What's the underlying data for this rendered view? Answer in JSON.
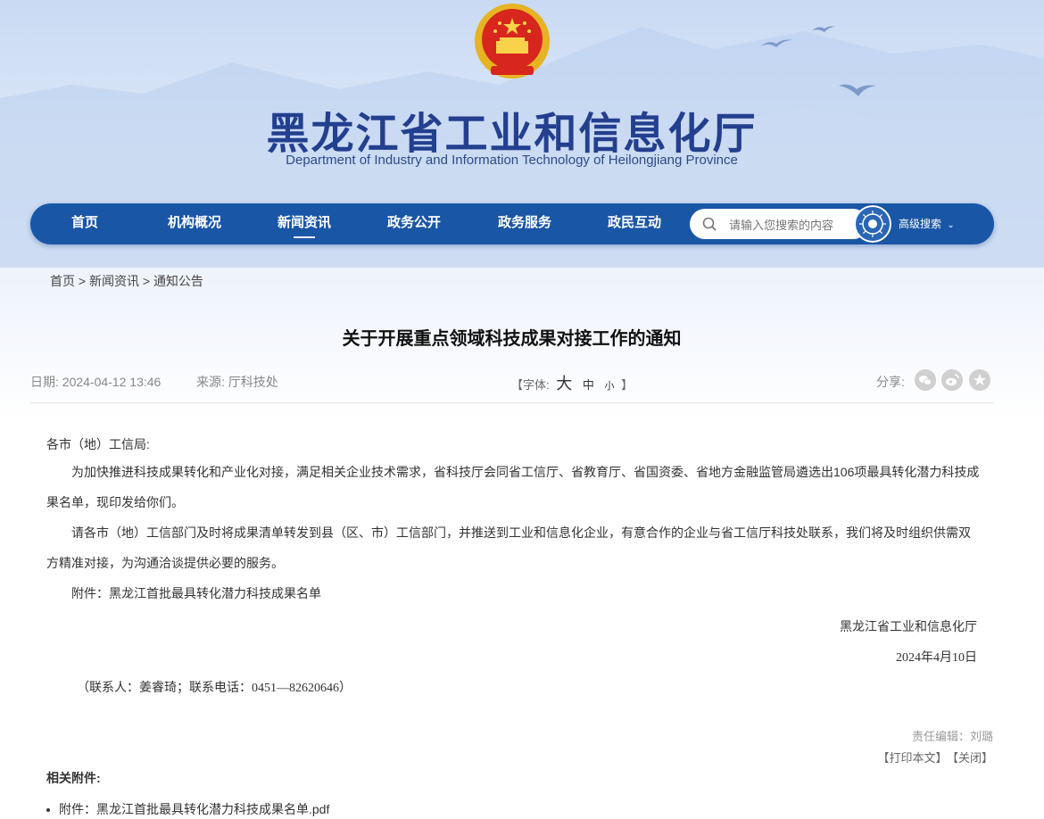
{
  "site": {
    "title_cn": "黑龙江省工业和信息化厅",
    "title_en": "Department of Industry and Information Technology of Heilongjiang Province"
  },
  "nav": {
    "items": [
      {
        "label": "首页"
      },
      {
        "label": "机构概况"
      },
      {
        "label": "新闻资讯",
        "active": true
      },
      {
        "label": "政务公开"
      },
      {
        "label": "政务服务"
      },
      {
        "label": "政民互动"
      }
    ],
    "search_placeholder": "请输入您搜索的内容",
    "advanced_search": "高级搜索"
  },
  "breadcrumb": {
    "home": "首页",
    "news": "新闻资讯",
    "notice": "通知公告",
    "sep": " > "
  },
  "article": {
    "title": "关于开展重点领域科技成果对接工作的通知",
    "date": "日期:  2024-04-12 13:46",
    "source": "来源:  厅科技处",
    "font_label": "【字体:",
    "font_large": "大",
    "font_medium": "中",
    "font_small": "小",
    "font_close": "】",
    "share_label": "分享:",
    "salutation": "各市（地）工信局:",
    "para1": "为加快推进科技成果转化和产业化对接，满足相关企业技术需求，省科技厅会同省工信厅、省教育厅、省国资委、省地方金融监管局遴选出106项最具转化潜力科技成果名单，现印发给你们。",
    "para2": "请各市（地）工信部门及时将成果清单转发到县（区、市）工信部门，并推送到工业和信息化企业，有意合作的企业与省工信厅科技处联系，我们将及时组织供需双方精准对接，为沟通洽谈提供必要的服务。",
    "attachment_line": "附件：黑龙江首批最具转化潜力科技成果名单",
    "signature": "黑龙江省工业和信息化厅",
    "sign_date": "2024年4月10日",
    "contact": "（联系人：姜睿琦；联系电话：0451—82620646）",
    "editor": "责任编辑：刘璐",
    "print": "【打印本文】",
    "close": "【关闭】",
    "related_title": "相关附件:",
    "related_file": "附件：黑龙江首批最具转化潜力科技成果名单.pdf"
  },
  "colors": {
    "nav_bg": "#1a56a6",
    "title_blue": "#233f8f"
  }
}
